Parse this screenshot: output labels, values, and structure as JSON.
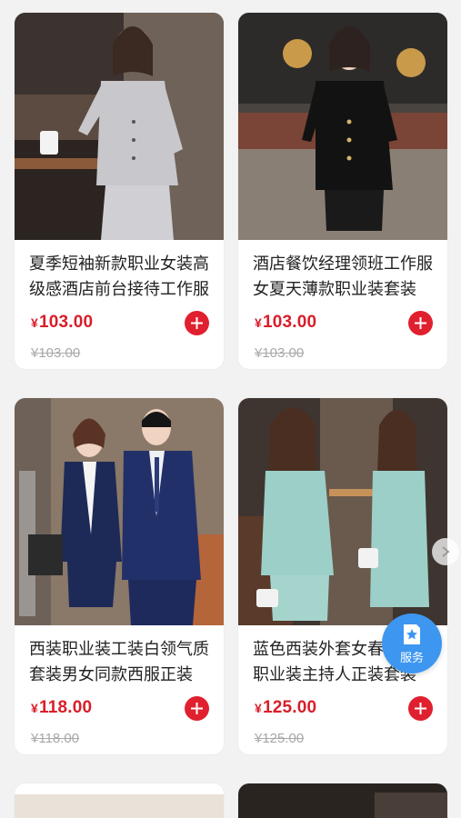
{
  "products": [
    {
      "title": "夏季短袖新款职业女装高级感酒店前台接待工作服",
      "currency": "¥",
      "price": "103.00",
      "original_price": "¥103.00",
      "image": "woman-grey-short-sleeve-suit"
    },
    {
      "title": "酒店餐饮经理领班工作服女夏天薄款职业装套装",
      "currency": "¥",
      "price": "103.00",
      "original_price": "¥103.00",
      "image": "woman-black-short-sleeve-suit"
    },
    {
      "title": "西装职业装工装白领气质套装男女同款西服正装",
      "currency": "¥",
      "price": "118.00",
      "original_price": "¥118.00",
      "image": "man-and-woman-navy-suits"
    },
    {
      "title": "蓝色西装外套女春秋高端职业装主持人正装套装",
      "currency": "¥",
      "price": "125.00",
      "original_price": "¥125.00",
      "image": "woman-mint-blazer-suit"
    }
  ],
  "service_button": {
    "label": "服务",
    "icon": "service-star-icon"
  },
  "colors": {
    "price": "#d81e2a",
    "add_button": "#e0202e",
    "service_fab": "#3d96f0",
    "page_bg": "#f2f2f2"
  }
}
